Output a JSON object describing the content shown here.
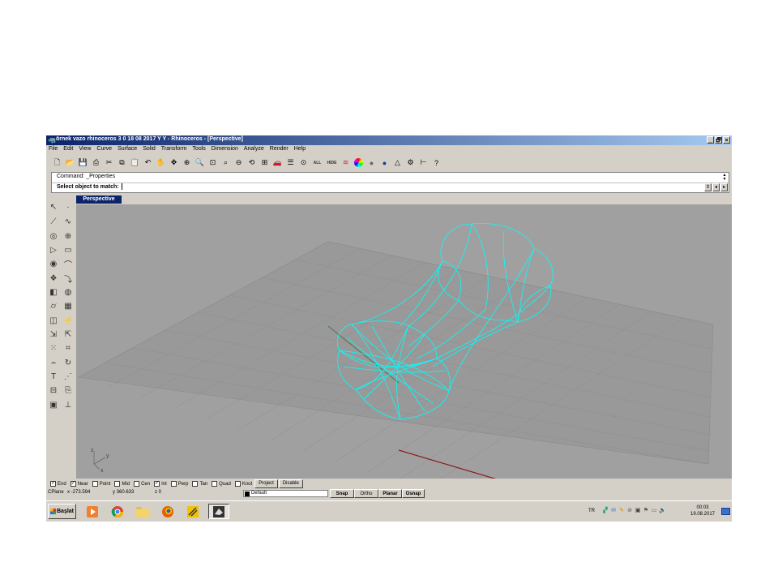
{
  "window": {
    "title": "örnek vazo rhinoceros 3 0 18 08 2017 Y Y - Rhinoceros - [Perspective]",
    "controls": {
      "minimize": "_",
      "restore": "🗗",
      "close": "×"
    }
  },
  "menubar": [
    "File",
    "Edit",
    "View",
    "Curve",
    "Surface",
    "Solid",
    "Transform",
    "Tools",
    "Dimension",
    "Analyze",
    "Render",
    "Help"
  ],
  "toolbar": {
    "icons": [
      "new-file-icon",
      "open-icon",
      "save-icon",
      "print-icon",
      "cut-icon",
      "copy-icon",
      "paste-icon",
      "undo-icon",
      "pan-hand-icon",
      "rotate-view-icon",
      "zoom-dynamic-icon",
      "zoom-window-icon",
      "zoom-extents-icon",
      "zoom-selected-icon",
      "undo-view-icon",
      "four-viewports-icon",
      "car-render-icon",
      "layer-stack-icon",
      "object-properties-icon"
    ],
    "text_buttons": [
      "ALL",
      "HIDE"
    ],
    "icons2": [
      "rainbow-icon",
      "color-wheel-icon",
      "sphere-gray-icon",
      "sphere-blue-icon",
      "cone-light-icon",
      "gear-settings-icon",
      "dimension-icon",
      "help-icon"
    ]
  },
  "command": {
    "history": "Command: _Properties",
    "prompt": "Select object to match:"
  },
  "viewport": {
    "label": "Perspective",
    "axes": {
      "x": "x",
      "y": "y",
      "z": "z"
    }
  },
  "osnap": {
    "items": [
      {
        "label": "End",
        "checked": true
      },
      {
        "label": "Near",
        "checked": true
      },
      {
        "label": "Point",
        "checked": false
      },
      {
        "label": "Mid",
        "checked": false
      },
      {
        "label": "Cen",
        "checked": false
      },
      {
        "label": "Int",
        "checked": true
      },
      {
        "label": "Perp",
        "checked": false
      },
      {
        "label": "Tan",
        "checked": false
      },
      {
        "label": "Quad",
        "checked": false
      },
      {
        "label": "Knot",
        "checked": false
      }
    ],
    "project": "Project",
    "disable": "Disable"
  },
  "status": {
    "cplane": "CPlane",
    "x": "x -273.594",
    "y": "y 360.633",
    "z": "z 0",
    "layer": "Default",
    "snap": "Snap",
    "ortho": "Ortho",
    "planar": "Planar",
    "osnap": "Osnap"
  },
  "taskbar": {
    "start": "Başlat",
    "language": "TR",
    "time": "00:03",
    "date": "19.08.2017"
  },
  "colors": {
    "title_active": "#0a246a",
    "viewport_bg": "#a0a0a0",
    "wireframe": "#00ffff",
    "x_axis": "#8b1a1a"
  }
}
